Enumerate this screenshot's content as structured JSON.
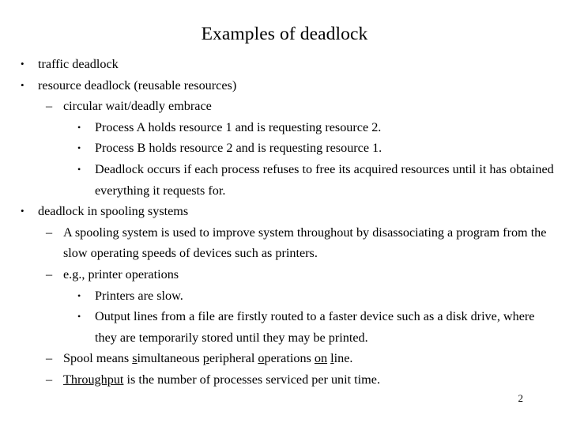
{
  "slide": {
    "title": "Examples of deadlock",
    "page_number": "2",
    "bullets": [
      {
        "level": 1,
        "marker": "•",
        "text": "traffic deadlock"
      },
      {
        "level": 1,
        "marker": "•",
        "text": "resource deadlock (reusable resources)"
      },
      {
        "level": 2,
        "marker": "–",
        "text": "circular wait/deadly embrace"
      },
      {
        "level": 3,
        "marker": "•",
        "text": "Process A holds resource 1 and is requesting resource 2."
      },
      {
        "level": 3,
        "marker": "•",
        "text": "Process B holds resource 2 and is requesting resource 1."
      },
      {
        "level": 3,
        "marker": "•",
        "text": "Deadlock occurs if each process refuses to free its acquired resources until it has obtained everything it requests for."
      },
      {
        "level": 1,
        "marker": "•",
        "text": "deadlock in spooling systems"
      },
      {
        "level": 2,
        "marker": "–",
        "text": "A spooling system is used to improve system throughout by disassociating a program from the slow operating speeds of devices such as printers."
      },
      {
        "level": 2,
        "marker": "–",
        "text": "e.g., printer operations"
      },
      {
        "level": 3,
        "marker": "•",
        "text": "Printers are slow."
      },
      {
        "level": 3,
        "marker": "•",
        "text": "Output lines from a file are firstly routed to a faster device such as a disk drive, where they are temporarily stored until they may be printed."
      },
      {
        "level": 2,
        "marker": "–",
        "text": "Spool means simultaneous peripheral operations on line.",
        "rich": [
          {
            "t": "Spool means "
          },
          {
            "t": "s",
            "underline": true
          },
          {
            "t": "imultaneous "
          },
          {
            "t": "p",
            "underline": true
          },
          {
            "t": "eripheral "
          },
          {
            "t": "o",
            "underline": true
          },
          {
            "t": "perations "
          },
          {
            "t": "on",
            "underline": true
          },
          {
            "t": " "
          },
          {
            "t": "l",
            "underline": true
          },
          {
            "t": "ine."
          }
        ]
      },
      {
        "level": 2,
        "marker": "–",
        "text": "Throughput is the number of processes serviced per unit time.",
        "rich": [
          {
            "t": "Throughput",
            "underline": true
          },
          {
            "t": " is the number of processes serviced per unit time."
          }
        ]
      }
    ]
  }
}
